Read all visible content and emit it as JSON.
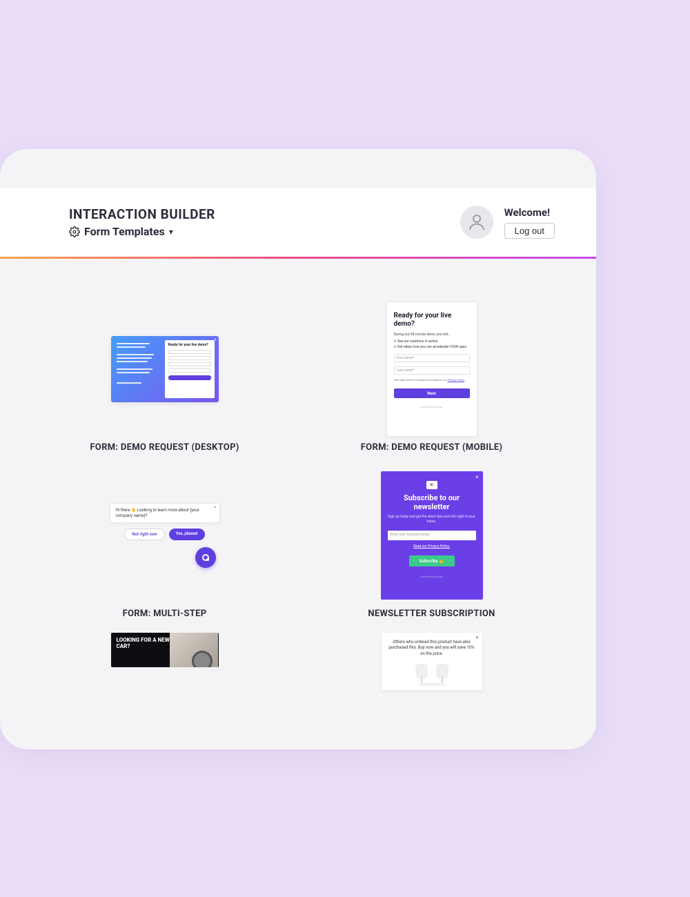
{
  "header": {
    "title": "INTERACTION BUILDER",
    "subtitle": "Form Templates",
    "welcome": "Welcome!",
    "logout": "Log out"
  },
  "cards": [
    {
      "title": "FORM: DEMO REQUEST (DESKTOP)"
    },
    {
      "title": "FORM: DEMO REQUEST (MOBILE)"
    },
    {
      "title": "FORM: MULTI-STEP"
    },
    {
      "title": "NEWSLETTER SUBSCRIPTION"
    },
    {
      "title": ""
    },
    {
      "title": ""
    }
  ],
  "thumbs": {
    "t1": {
      "heading": "Ready for your live demo?"
    },
    "t2": {
      "heading": "Ready for your live demo?",
      "sub": "During our 30-minute demo you will…",
      "b1": "✔ See our solutions in action",
      "b2": "✔ Get ideas how you can accelerate YOUR saas",
      "ph1": "First name*",
      "ph2": "Last name*",
      "priv": "Your data will be managed according to our ",
      "privlink": "Privacy Policy",
      "btn": "Next",
      "pow": "powered by giosg"
    },
    "t3": {
      "msg": "Hi there 👋 Looking to learn more about {your company name}?",
      "no": "Not right now",
      "yes": "Yes, please!"
    },
    "t4": {
      "heading": "Subscribe to our newsletter",
      "sub": "Sign up today and get the latest tips and info right to your inbox.",
      "ph": "Enter your business email",
      "priv": "Read our Privacy Policy.",
      "btn": "Subscribe 👍",
      "pow": "powered by giosg"
    },
    "t5": {
      "heading": "LOOKING FOR A NEW CAR?"
    },
    "t6": {
      "text": "Others who ordered this product have also purchased this. Buy now and you will save 10% on the price."
    }
  }
}
